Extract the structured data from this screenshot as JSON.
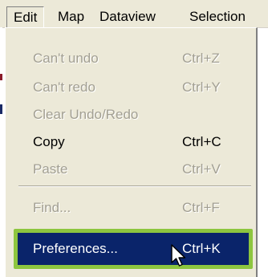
{
  "menubar": {
    "items": [
      {
        "label": "Edit",
        "active": true
      },
      {
        "label": "Map"
      },
      {
        "label": "Dataview"
      },
      {
        "label": "Selection"
      }
    ]
  },
  "edit_menu": {
    "items": [
      {
        "label": "Can't undo",
        "shortcut": "Ctrl+Z",
        "enabled": false
      },
      {
        "label": "Can't redo",
        "shortcut": "Ctrl+Y",
        "enabled": false
      },
      {
        "label": "Clear Undo/Redo",
        "shortcut": "",
        "enabled": false
      },
      {
        "label": "Copy",
        "shortcut": "Ctrl+C",
        "enabled": true
      },
      {
        "label": "Paste",
        "shortcut": "Ctrl+V",
        "enabled": false
      },
      {
        "label": "Find...",
        "shortcut": "Ctrl+F",
        "enabled": false
      },
      {
        "label": "Preferences...",
        "shortcut": "Ctrl+K",
        "enabled": true,
        "highlighted": true
      }
    ]
  },
  "colors": {
    "menu_background": "#ece9d8",
    "highlight_background": "#0a246a",
    "highlight_ring": "#8dc63f",
    "disabled_text": "#a29f92"
  }
}
